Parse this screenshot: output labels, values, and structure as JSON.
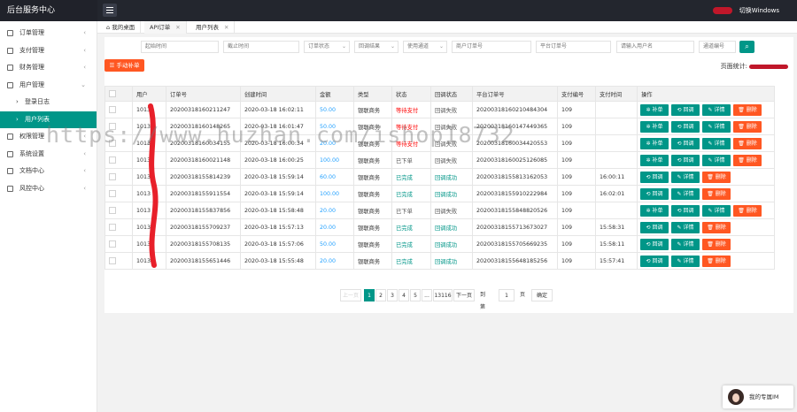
{
  "app": {
    "title": "后台服务中心",
    "user_label": "切换Windows"
  },
  "sidebar": {
    "items": [
      {
        "label": "订单管理",
        "has_arrow": true
      },
      {
        "label": "支付管理",
        "has_arrow": true
      },
      {
        "label": "财务管理",
        "has_arrow": true
      },
      {
        "label": "用户管理",
        "has_arrow": true
      }
    ],
    "subitems": [
      {
        "label": "登录日志"
      },
      {
        "label": "用户列表"
      }
    ],
    "items2": [
      {
        "label": "权限管理",
        "has_arrow": true
      },
      {
        "label": "系统设置",
        "has_arrow": true
      },
      {
        "label": "文档中心",
        "has_arrow": true
      },
      {
        "label": "风控中心",
        "has_arrow": true
      }
    ]
  },
  "tabs": [
    {
      "label": "我的桌面"
    },
    {
      "label": "API订单"
    },
    {
      "label": "用户列表"
    }
  ],
  "filters": {
    "start_time": "起始时间",
    "end_time": "截止时间",
    "order_status": "订单状态",
    "callback_result": "回调结果",
    "channel": "使用通道",
    "merchant_order_no": "商户订单号",
    "platform_order_no": "平台订单号",
    "username": "请输入用户名",
    "channel_code": "通道编号"
  },
  "toolbar": {
    "manual_add": "手动补单",
    "stats_label": "页面统计:"
  },
  "table": {
    "headers": [
      "用户",
      "订单号",
      "创建时间",
      "金额",
      "类型",
      "状态",
      "回调状态",
      "平台订单号",
      "支付编号",
      "支付时间",
      "操作"
    ],
    "buttons": {
      "supplement": "补单",
      "callback": "回调",
      "detail": "详情",
      "delete": "删除"
    },
    "rows": [
      {
        "user": "1013",
        "order": "20200318160211247",
        "created": "2020-03-18 16:02:11",
        "amount": "50.00",
        "type": "银联商务",
        "status": "等待支付",
        "status_class": "st-red",
        "cb": "回调失败",
        "cb_class": "cb-fail",
        "platform": "2020031816021048430​4",
        "payno": "109",
        "paytime": "",
        "ops": [
          "supplement",
          "callback",
          "detail",
          "delete"
        ]
      },
      {
        "user": "1013",
        "order": "20200318160148265",
        "created": "2020-03-18 16:01:47",
        "amount": "50.00",
        "type": "银联商务",
        "status": "等待支付",
        "status_class": "st-red",
        "cb": "回调失败",
        "cb_class": "cb-fail",
        "platform": "202003181601474493​65",
        "payno": "109",
        "paytime": "",
        "ops": [
          "supplement",
          "callback",
          "detail",
          "delete"
        ]
      },
      {
        "user": "1013",
        "order": "20200318160034155",
        "created": "2020-03-18 16:00:34",
        "amount": "20.00",
        "type": "银联商务",
        "status": "等待支付",
        "status_class": "st-red",
        "cb": "回调失败",
        "cb_class": "cb-fail",
        "platform": "202003181600344205​53",
        "payno": "109",
        "paytime": "",
        "ops": [
          "supplement",
          "callback",
          "detail",
          "delete"
        ]
      },
      {
        "user": "1013",
        "order": "20200318160021148",
        "created": "2020-03-18 16:00:25",
        "amount": "100.00",
        "type": "银联商务",
        "status": "已下单",
        "status_class": "st-gray",
        "cb": "回调失败",
        "cb_class": "cb-fail",
        "platform": "202003181600251260​85",
        "payno": "109",
        "paytime": "",
        "ops": [
          "supplement",
          "callback",
          "detail",
          "delete"
        ]
      },
      {
        "user": "1013",
        "order": "20200318155814239",
        "created": "2020-03-18 15:59:14",
        "amount": "60.00",
        "type": "银联商务",
        "status": "已完成",
        "status_class": "st-green",
        "cb": "回调成功",
        "cb_class": "cb-ok",
        "platform": "202003181558131620​53",
        "payno": "109",
        "paytime": "16:00:11",
        "ops": [
          "callback",
          "detail",
          "delete"
        ]
      },
      {
        "user": "1013",
        "order": "20200318155911554",
        "created": "2020-03-18 15:59:14",
        "amount": "100.00",
        "type": "银联商务",
        "status": "已完成",
        "status_class": "st-green",
        "cb": "回调成功",
        "cb_class": "cb-ok",
        "platform": "202003181559102229​84",
        "payno": "109",
        "paytime": "16:02:01",
        "ops": [
          "callback",
          "detail",
          "delete"
        ]
      },
      {
        "user": "1013",
        "order": "20200318155837856",
        "created": "2020-03-18 15:58:48",
        "amount": "20.00",
        "type": "银联商务",
        "status": "已下单",
        "status_class": "st-gray",
        "cb": "回调失败",
        "cb_class": "cb-fail",
        "platform": "202003181558488205​26",
        "payno": "109",
        "paytime": "",
        "ops": [
          "supplement",
          "callback",
          "detail",
          "delete"
        ]
      },
      {
        "user": "1013",
        "order": "20200318155709237",
        "created": "2020-03-18 15:57:13",
        "amount": "20.00",
        "type": "银联商务",
        "status": "已完成",
        "status_class": "st-green",
        "cb": "回调成功",
        "cb_class": "cb-ok",
        "platform": "202003181557136730​27",
        "payno": "109",
        "paytime": "15:58:31",
        "ops": [
          "callback",
          "detail",
          "delete"
        ]
      },
      {
        "user": "1013",
        "order": "20200318155708135",
        "created": "2020-03-18 15:57:06",
        "amount": "50.00",
        "type": "银联商务",
        "status": "已完成",
        "status_class": "st-green",
        "cb": "回调成功",
        "cb_class": "cb-ok",
        "platform": "202003181557056692​35",
        "payno": "109",
        "paytime": "15:58:11",
        "ops": [
          "callback",
          "detail",
          "delete"
        ]
      },
      {
        "user": "1013",
        "order": "20200318155651446",
        "created": "2020-03-18 15:55:48",
        "amount": "20.00",
        "type": "银联商务",
        "status": "已完成",
        "status_class": "st-green",
        "cb": "回调成功",
        "cb_class": "cb-ok",
        "platform": "202003181556481852​56",
        "payno": "109",
        "paytime": "15:57:41",
        "ops": [
          "callback",
          "detail",
          "delete"
        ]
      }
    ]
  },
  "pagination": {
    "prev": "上一页",
    "pages": [
      "1",
      "2",
      "3",
      "4",
      "5"
    ],
    "ellipsis": "...",
    "last": "13116",
    "next": "下一页",
    "goto_label": "到第",
    "goto_value": "1",
    "page_unit": "页",
    "confirm": "确定"
  },
  "watermark": "https://www.huzhan.com/ishop18732",
  "im_widget": {
    "label": "我的专属IM"
  },
  "colors": {
    "primary": "#009688",
    "danger": "#ff5722",
    "topbar": "#23262e",
    "status_wait": "#ff0000",
    "amount": "#1e9fff"
  },
  "icons": {
    "menu": "hamburger-icon",
    "search": "search-icon",
    "close": "close-icon",
    "home": "home-icon"
  }
}
